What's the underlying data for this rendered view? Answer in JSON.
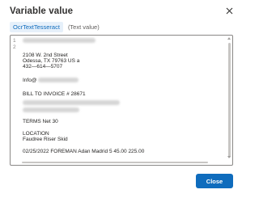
{
  "dialog": {
    "title": "Variable value",
    "close_label": "Close"
  },
  "variable": {
    "name": "OcrTextTesseract",
    "type": "(Text value)"
  },
  "editor": {
    "line_numbers": [
      "1",
      "2"
    ],
    "lines": [
      "2108 W. 2nd Street",
      "Odessa, TX 79763 US a",
      "432—614—5707",
      "Info@",
      "BILL TO INVOICE # 28671",
      "TERMS Net 30",
      "LOCATION",
      "Faudree Riser Skid",
      "02/25/2022 FOREMAN Adan Madrid 5 45.00 225.00"
    ]
  },
  "colors": {
    "accent": "#0f6cbd",
    "chip_bg": "#e6f0fa",
    "text": "#201f1e",
    "muted": "#605e5c"
  }
}
